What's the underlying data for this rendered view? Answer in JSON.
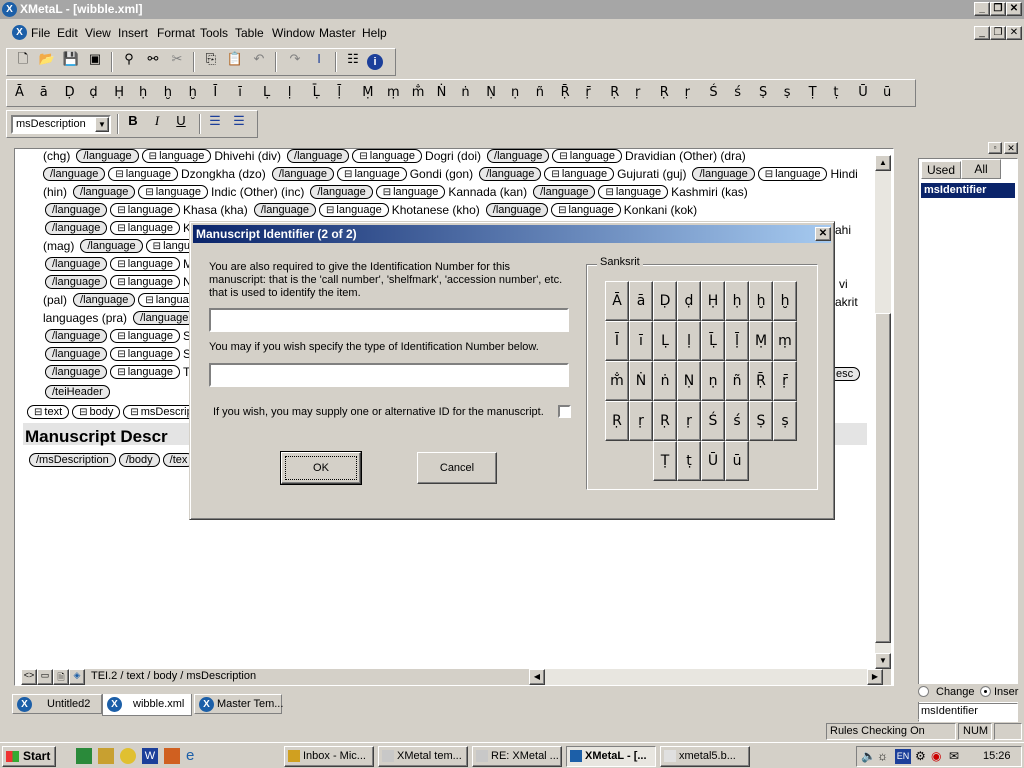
{
  "window": {
    "title": "XMetaL - [wibble.xml]"
  },
  "menu": [
    "File",
    "Edit",
    "View",
    "Insert",
    "Format",
    "Tools",
    "Table",
    "Window",
    "Master",
    "Help"
  ],
  "toolbar_style": {
    "element_select": "msDescription",
    "bold": "B",
    "italic": "I",
    "underline": "U"
  },
  "special_chars": [
    "Ā",
    "ā",
    "Ḍ",
    "ḍ",
    "Ḥ",
    "ḥ",
    "ḫ",
    "ḫ",
    "Ī",
    "ī",
    "Ḷ",
    "ḷ",
    "Ḹ",
    "ḹ",
    "Ṃ",
    "ṃ",
    "m̐",
    "Ṅ",
    "ṅ",
    "Ṇ",
    "ṇ",
    "ñ",
    "Ṝ",
    "ṝ",
    "Ṛ",
    "ṛ",
    "Ṛ",
    "ṛ",
    "Ś",
    "ś",
    "Ṣ",
    "ṣ",
    "Ṭ",
    "ṭ",
    "Ū",
    "ū"
  ],
  "document": {
    "lines": [
      [
        {
          "t": "txt",
          "v": "(chg)"
        },
        {
          "t": "end",
          "v": "/language"
        },
        {
          "t": "start",
          "v": "language"
        },
        {
          "t": "txt",
          "v": "Dhivehi (div)"
        },
        {
          "t": "end",
          "v": "/language"
        },
        {
          "t": "start",
          "v": "language"
        },
        {
          "t": "txt",
          "v": "Dogri (doi)"
        },
        {
          "t": "end",
          "v": "/language"
        },
        {
          "t": "start",
          "v": "language"
        },
        {
          "t": "txt",
          "v": "Dravidian (Other) (dra)"
        }
      ],
      [
        {
          "t": "end",
          "v": "/language"
        },
        {
          "t": "start",
          "v": "language"
        },
        {
          "t": "txt",
          "v": "Dzongkha (dzo)"
        },
        {
          "t": "end",
          "v": "/language"
        },
        {
          "t": "start",
          "v": "language"
        },
        {
          "t": "txt",
          "v": "Gondi (gon)"
        },
        {
          "t": "end",
          "v": "/language"
        },
        {
          "t": "start",
          "v": "language"
        },
        {
          "t": "txt",
          "v": "Gujurati (guj)"
        },
        {
          "t": "end",
          "v": "/language"
        },
        {
          "t": "start",
          "v": "language"
        },
        {
          "t": "txt",
          "v": "Hindi"
        }
      ],
      [
        {
          "t": "txt",
          "v": "(hin)"
        },
        {
          "t": "end",
          "v": "/language"
        },
        {
          "t": "start",
          "v": "language"
        },
        {
          "t": "txt",
          "v": "Indic (Other) (inc)"
        },
        {
          "t": "end",
          "v": "/language"
        },
        {
          "t": "start",
          "v": "language"
        },
        {
          "t": "txt",
          "v": "Kannada (kan)"
        },
        {
          "t": "end",
          "v": "/language"
        },
        {
          "t": "start",
          "v": "language"
        },
        {
          "t": "txt",
          "v": "Kashmiri (kas)"
        }
      ],
      [
        {
          "t": "end",
          "v": "/language"
        },
        {
          "t": "start",
          "v": "language"
        },
        {
          "t": "txt",
          "v": "Khasa (kha)"
        },
        {
          "t": "end",
          "v": "/language"
        },
        {
          "t": "start",
          "v": "language"
        },
        {
          "t": "txt",
          "v": "Khotanese (kho)"
        },
        {
          "t": "end",
          "v": "/language"
        },
        {
          "t": "start",
          "v": "language"
        },
        {
          "t": "txt",
          "v": "Konkani (kok)"
        }
      ],
      [
        {
          "t": "end",
          "v": "/language"
        },
        {
          "t": "start",
          "v": "language"
        },
        {
          "t": "txt",
          "v": "Ku"
        }
      ],
      [
        {
          "t": "txt",
          "v": "(mag)"
        },
        {
          "t": "end",
          "v": "/language"
        },
        {
          "t": "start",
          "v": "langua"
        }
      ],
      [
        {
          "t": "end",
          "v": "/language"
        },
        {
          "t": "start",
          "v": "language"
        },
        {
          "t": "txt",
          "v": "M"
        }
      ],
      [
        {
          "t": "end",
          "v": "/language"
        },
        {
          "t": "start",
          "v": "language"
        },
        {
          "t": "txt",
          "v": "Ne"
        }
      ],
      [
        {
          "t": "txt",
          "v": "(pal)"
        },
        {
          "t": "end",
          "v": "/language"
        },
        {
          "t": "start",
          "v": "language"
        }
      ],
      [
        {
          "t": "txt",
          "v": "languages (pra)"
        },
        {
          "t": "end",
          "v": "/language"
        }
      ],
      [
        {
          "t": "end",
          "v": "/language"
        },
        {
          "t": "start",
          "v": "language"
        },
        {
          "t": "txt",
          "v": "Sa"
        }
      ],
      [
        {
          "t": "end",
          "v": "/language"
        },
        {
          "t": "start",
          "v": "language"
        },
        {
          "t": "txt",
          "v": "Si"
        }
      ],
      [
        {
          "t": "end",
          "v": "/language"
        },
        {
          "t": "start",
          "v": "language"
        },
        {
          "t": "txt",
          "v": "Th"
        }
      ],
      [
        {
          "t": "end",
          "v": "/teiHeader"
        }
      ],
      [
        {
          "t": "start",
          "v": "text"
        },
        {
          "t": "start",
          "v": "body"
        },
        {
          "t": "start",
          "v": "msDescrip"
        }
      ]
    ],
    "right_fragments": {
      "ahi": "ahi",
      "vi": "vi",
      "rakrit": "rakrit",
      "esc": "esc"
    },
    "heading": "Manuscript Descr",
    "closing": [
      "/msDescription",
      "/body",
      "/tex"
    ],
    "path": "TEI.2 / text / body / msDescription"
  },
  "dialog": {
    "title": "Manuscript Identifier (2 of 2)",
    "prompt1": "You are also required to give the Identification Number for this manuscript: that is the 'call number', 'shelfmark', 'accession number', etc. that is used to identify the item.",
    "id_value": "",
    "prompt2": "You may if you wish specify the type of Identification Number below.",
    "type_value": "",
    "alt_prompt": "If you wish, you may supply one or alternative ID for the manuscript.",
    "ok": "OK",
    "cancel": "Cancel",
    "group_label": "Sanksrit",
    "chars": [
      [
        "Ā",
        "ā",
        "Ḍ",
        "ḍ",
        "Ḥ",
        "ḥ",
        "ḫ",
        "ḫ"
      ],
      [
        "Ī",
        "ī",
        "Ḷ",
        "ḷ",
        "Ḹ",
        "ḹ",
        "Ṃ",
        "ṃ"
      ],
      [
        "m̐",
        "Ṅ",
        "ṅ",
        "Ṇ",
        "ṇ",
        "ñ",
        "Ṝ",
        "ṝ"
      ],
      [
        "Ṛ",
        "ṛ",
        "Ṛ",
        "ṛ",
        "Ś",
        "ś",
        "Ṣ",
        "ṣ"
      ],
      [
        "Ṭ",
        "ṭ",
        "Ū",
        "ū"
      ]
    ]
  },
  "side_panel": {
    "tabs": [
      "Used",
      "All"
    ],
    "items": [
      "msIdentifier"
    ],
    "radio_change": "Change",
    "radio_insert": "Inser",
    "current": "msIdentifier"
  },
  "doc_tabs": [
    "Untitled2",
    "wibble.xml",
    "Master Tem..."
  ],
  "status": {
    "rules": "Rules Checking On",
    "num": "NUM"
  },
  "taskbar": {
    "start": "Start",
    "items": [
      "Inbox - Mic...",
      "XMetal tem...",
      "RE: XMetal ...",
      "XMetaL - [...",
      "xmetal5.b..."
    ],
    "clock": "15:26",
    "lang": "EN"
  }
}
